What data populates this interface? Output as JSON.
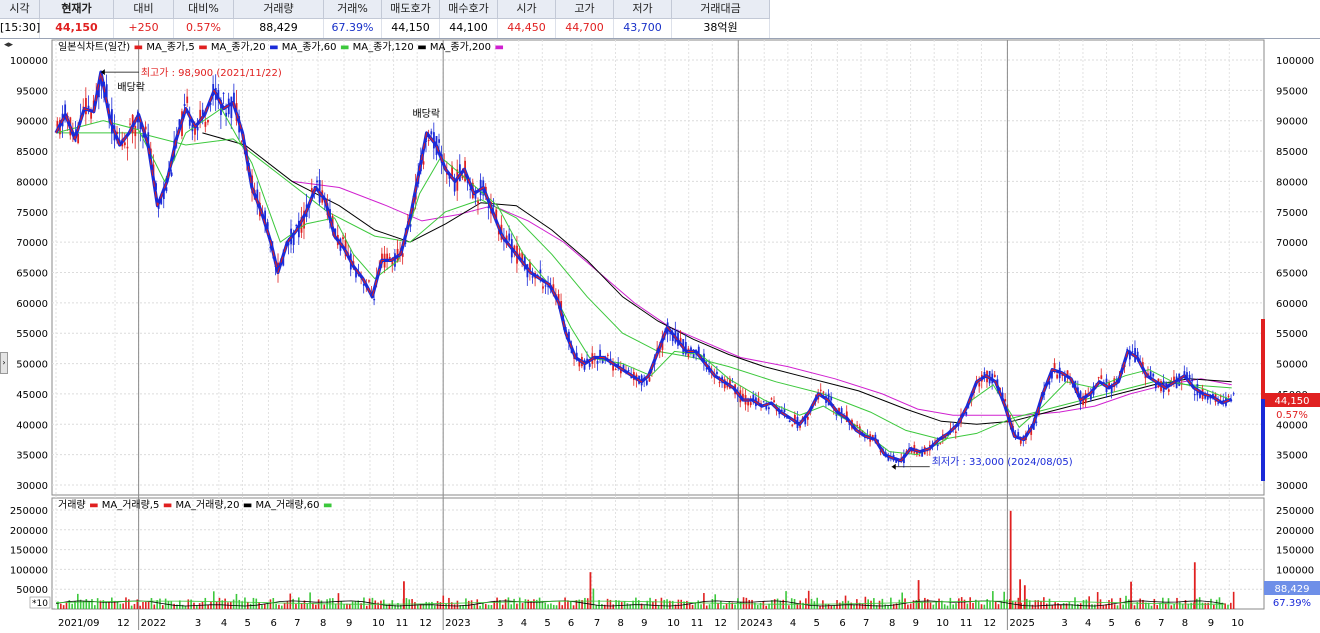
{
  "quote": {
    "headers": [
      "시각",
      "현재가",
      "대비",
      "대비%",
      "거래량",
      "거래%",
      "매도호가",
      "매수호가",
      "시가",
      "고가",
      "저가",
      "거래대금"
    ],
    "values": [
      "[15:30]",
      "44,150",
      "+250",
      "0.57%",
      "88,429",
      "67.39%",
      "44,150",
      "44,100",
      "44,450",
      "44,700",
      "43,700",
      "38억원"
    ]
  },
  "chart_data": {
    "type": "line",
    "title": "일본식차트(일간)",
    "price_legend": [
      {
        "label": "MA_종가,5",
        "color": "#e02020"
      },
      {
        "label": "MA_종가,20",
        "color": "#e02020"
      },
      {
        "label": "MA_종가,60",
        "color": "#1a2ad8"
      },
      {
        "label": "MA_종가,120",
        "color": "#3cc83c"
      },
      {
        "label": "MA_종가,200",
        "color": "#000000"
      },
      {
        "label": "",
        "color": "#d020d0"
      }
    ],
    "volume_legend": [
      {
        "label": "거래량",
        "color": "#e02020"
      },
      {
        "label": "MA_거래량,5",
        "color": "#e02020"
      },
      {
        "label": "MA_거래량,20",
        "color": "#000000"
      },
      {
        "label": "MA_거래량,60",
        "color": "#3cc83c"
      }
    ],
    "price_ylim": [
      30000,
      100000
    ],
    "price_ticks": [
      30000,
      35000,
      40000,
      45000,
      50000,
      55000,
      60000,
      65000,
      70000,
      75000,
      80000,
      85000,
      90000,
      95000,
      100000
    ],
    "volume_ylim": [
      0,
      250000
    ],
    "volume_ticks": [
      50000,
      100000,
      150000,
      200000,
      250000
    ],
    "volume_scale_tag": "*10",
    "x_labels": [
      {
        "t": 0,
        "label": "2021/09"
      },
      {
        "t": 2.5,
        "label": "12"
      },
      {
        "t": 3.5,
        "label": "2022"
      },
      {
        "t": 5.8,
        "label": "3"
      },
      {
        "t": 6.9,
        "label": "4"
      },
      {
        "t": 7.9,
        "label": "5"
      },
      {
        "t": 9.0,
        "label": "6"
      },
      {
        "t": 10.0,
        "label": "7"
      },
      {
        "t": 11.1,
        "label": "8"
      },
      {
        "t": 12.2,
        "label": "9"
      },
      {
        "t": 13.3,
        "label": "10"
      },
      {
        "t": 14.3,
        "label": "11"
      },
      {
        "t": 15.3,
        "label": "12"
      },
      {
        "t": 16.4,
        "label": "2023"
      },
      {
        "t": 18.6,
        "label": "3"
      },
      {
        "t": 19.6,
        "label": "4"
      },
      {
        "t": 20.6,
        "label": "5"
      },
      {
        "t": 21.6,
        "label": "6"
      },
      {
        "t": 22.7,
        "label": "7"
      },
      {
        "t": 23.7,
        "label": "8"
      },
      {
        "t": 24.7,
        "label": "9"
      },
      {
        "t": 25.8,
        "label": "10"
      },
      {
        "t": 26.8,
        "label": "11"
      },
      {
        "t": 27.8,
        "label": "12"
      },
      {
        "t": 28.9,
        "label": "2024"
      },
      {
        "t": 30.0,
        "label": "3"
      },
      {
        "t": 31.0,
        "label": "4"
      },
      {
        "t": 32.0,
        "label": "5"
      },
      {
        "t": 33.1,
        "label": "6"
      },
      {
        "t": 34.1,
        "label": "7"
      },
      {
        "t": 35.2,
        "label": "8"
      },
      {
        "t": 36.2,
        "label": "9"
      },
      {
        "t": 37.2,
        "label": "10"
      },
      {
        "t": 38.2,
        "label": "11"
      },
      {
        "t": 39.2,
        "label": "12"
      },
      {
        "t": 40.3,
        "label": "2025"
      },
      {
        "t": 42.5,
        "label": "3"
      },
      {
        "t": 43.5,
        "label": "4"
      },
      {
        "t": 44.5,
        "label": "5"
      },
      {
        "t": 45.6,
        "label": "6"
      },
      {
        "t": 46.6,
        "label": "7"
      },
      {
        "t": 47.6,
        "label": "8"
      },
      {
        "t": 48.7,
        "label": "9"
      },
      {
        "t": 49.7,
        "label": "10"
      }
    ],
    "year_lines_t": [
      3.5,
      16.4,
      28.9,
      40.3
    ],
    "x_range": [
      0,
      51
    ],
    "price_path": [
      [
        0,
        88000
      ],
      [
        0.4,
        91000
      ],
      [
        0.8,
        87000
      ],
      [
        1.2,
        92000
      ],
      [
        1.6,
        91500
      ],
      [
        1.9,
        98000
      ],
      [
        2.3,
        90000
      ],
      [
        2.7,
        86000
      ],
      [
        3.1,
        88000
      ],
      [
        3.5,
        91000
      ],
      [
        3.9,
        86000
      ],
      [
        4.3,
        76000
      ],
      [
        4.7,
        80000
      ],
      [
        5.1,
        87000
      ],
      [
        5.5,
        92000
      ],
      [
        5.9,
        89000
      ],
      [
        6.3,
        91000
      ],
      [
        6.7,
        95000
      ],
      [
        7.1,
        92000
      ],
      [
        7.5,
        93000
      ],
      [
        7.9,
        88000
      ],
      [
        8.3,
        79000
      ],
      [
        8.7,
        75000
      ],
      [
        9.1,
        70000
      ],
      [
        9.4,
        65000
      ],
      [
        9.8,
        70000
      ],
      [
        10.2,
        72000
      ],
      [
        10.6,
        75000
      ],
      [
        11.0,
        79000
      ],
      [
        11.4,
        77000
      ],
      [
        11.8,
        71000
      ],
      [
        12.2,
        69000
      ],
      [
        12.6,
        66000
      ],
      [
        13.0,
        64000
      ],
      [
        13.4,
        61000
      ],
      [
        13.8,
        67000
      ],
      [
        14.2,
        67000
      ],
      [
        14.6,
        68000
      ],
      [
        15.0,
        74000
      ],
      [
        15.4,
        82000
      ],
      [
        15.7,
        88000
      ],
      [
        16.1,
        86000
      ],
      [
        16.5,
        82000
      ],
      [
        16.9,
        80000
      ],
      [
        17.3,
        82000
      ],
      [
        17.7,
        78000
      ],
      [
        18.1,
        79000
      ],
      [
        18.5,
        75000
      ],
      [
        18.9,
        71000
      ],
      [
        19.3,
        69000
      ],
      [
        19.7,
        67000
      ],
      [
        20.1,
        65000
      ],
      [
        20.5,
        64000
      ],
      [
        20.9,
        63000
      ],
      [
        21.3,
        60000
      ],
      [
        21.6,
        55000
      ],
      [
        22.0,
        51000
      ],
      [
        22.4,
        50000
      ],
      [
        22.8,
        51000
      ],
      [
        23.2,
        51000
      ],
      [
        23.6,
        50000
      ],
      [
        24.0,
        49000
      ],
      [
        24.4,
        48000
      ],
      [
        24.8,
        47000
      ],
      [
        25.1,
        48000
      ],
      [
        25.5,
        52000
      ],
      [
        25.9,
        56000
      ],
      [
        26.3,
        54000
      ],
      [
        26.7,
        52000
      ],
      [
        27.1,
        52000
      ],
      [
        27.5,
        50000
      ],
      [
        27.9,
        48000
      ],
      [
        28.3,
        47000
      ],
      [
        28.7,
        46000
      ],
      [
        29.1,
        44000
      ],
      [
        29.5,
        44000
      ],
      [
        29.9,
        43000
      ],
      [
        30.3,
        43500
      ],
      [
        30.7,
        42000
      ],
      [
        31.1,
        41000
      ],
      [
        31.5,
        40000
      ],
      [
        31.9,
        42000
      ],
      [
        32.3,
        45000
      ],
      [
        32.7,
        44000
      ],
      [
        33.1,
        42000
      ],
      [
        33.5,
        41000
      ],
      [
        33.9,
        39000
      ],
      [
        34.3,
        38000
      ],
      [
        34.7,
        37500
      ],
      [
        35.1,
        35000
      ],
      [
        35.4,
        34500
      ],
      [
        35.8,
        34000
      ],
      [
        36.2,
        36000
      ],
      [
        36.6,
        35500
      ],
      [
        37.0,
        36000
      ],
      [
        37.4,
        37500
      ],
      [
        37.8,
        38500
      ],
      [
        38.2,
        40000
      ],
      [
        38.6,
        43000
      ],
      [
        39.0,
        47000
      ],
      [
        39.4,
        48000
      ],
      [
        39.8,
        47000
      ],
      [
        40.2,
        43000
      ],
      [
        40.6,
        38000
      ],
      [
        41.0,
        37500
      ],
      [
        41.4,
        40000
      ],
      [
        41.8,
        45000
      ],
      [
        42.2,
        49000
      ],
      [
        42.6,
        48500
      ],
      [
        43.0,
        47500
      ],
      [
        43.4,
        44000
      ],
      [
        43.8,
        45000
      ],
      [
        44.2,
        47000
      ],
      [
        44.6,
        46000
      ],
      [
        45.0,
        47000
      ],
      [
        45.4,
        52000
      ],
      [
        45.8,
        51000
      ],
      [
        46.2,
        48000
      ],
      [
        46.6,
        47000
      ],
      [
        47.0,
        46000
      ],
      [
        47.4,
        47000
      ],
      [
        47.8,
        48000
      ],
      [
        48.2,
        46000
      ],
      [
        48.6,
        45000
      ],
      [
        49.0,
        44500
      ],
      [
        49.4,
        43500
      ],
      [
        49.8,
        44150
      ]
    ],
    "ma20_path": [
      [
        0,
        88000
      ],
      [
        2,
        90000
      ],
      [
        3.5,
        88500
      ],
      [
        4.6,
        80000
      ],
      [
        5.5,
        88000
      ],
      [
        7.0,
        92000
      ],
      [
        8.3,
        83000
      ],
      [
        9.5,
        70000
      ],
      [
        10.6,
        73000
      ],
      [
        11.8,
        74000
      ],
      [
        12.6,
        68000
      ],
      [
        13.5,
        64000
      ],
      [
        14.5,
        67000
      ],
      [
        15.4,
        78000
      ],
      [
        16.3,
        84000
      ],
      [
        17.5,
        80000
      ],
      [
        18.7,
        76000
      ],
      [
        19.8,
        68000
      ],
      [
        20.9,
        63000
      ],
      [
        21.8,
        56000
      ],
      [
        22.6,
        51000
      ],
      [
        24.0,
        50000
      ],
      [
        25.2,
        48000
      ],
      [
        26.2,
        52000
      ],
      [
        27.3,
        51500
      ],
      [
        28.5,
        47500
      ],
      [
        30.0,
        44000
      ],
      [
        31.5,
        41500
      ],
      [
        32.5,
        43000
      ],
      [
        33.8,
        40000
      ],
      [
        35.3,
        35500
      ],
      [
        36.5,
        35000
      ],
      [
        37.7,
        37500
      ],
      [
        38.8,
        44000
      ],
      [
        39.7,
        46500
      ],
      [
        40.8,
        39500
      ],
      [
        41.8,
        43000
      ],
      [
        42.8,
        47000
      ],
      [
        44.0,
        46000
      ],
      [
        45.3,
        48000
      ],
      [
        46.3,
        49000
      ],
      [
        47.3,
        47000
      ],
      [
        48.5,
        46000
      ],
      [
        49.8,
        44000
      ]
    ],
    "ma60_path": [
      [
        0,
        88000
      ],
      [
        2,
        90000
      ],
      [
        3.5,
        87000
      ],
      [
        5.2,
        82000
      ],
      [
        6.5,
        88000
      ],
      [
        7.8,
        89000
      ],
      [
        9.0,
        80000
      ],
      [
        10.6,
        74000
      ],
      [
        11.8,
        76000
      ],
      [
        13.0,
        70000
      ],
      [
        14.2,
        66000
      ],
      [
        15.2,
        70000
      ],
      [
        16.5,
        80000
      ],
      [
        17.8,
        78000
      ],
      [
        19.0,
        75000
      ],
      [
        20.4,
        68000
      ],
      [
        21.6,
        60000
      ],
      [
        22.8,
        54000
      ],
      [
        24.2,
        51000
      ],
      [
        25.8,
        49500
      ],
      [
        27.2,
        51000
      ],
      [
        28.6,
        49000
      ],
      [
        30.5,
        45500
      ],
      [
        32.0,
        43500
      ],
      [
        33.6,
        42500
      ],
      [
        35.0,
        39500
      ],
      [
        36.3,
        36500
      ],
      [
        37.6,
        36000
      ],
      [
        38.8,
        39000
      ],
      [
        40.0,
        42000
      ],
      [
        41.2,
        42000
      ],
      [
        42.5,
        44000
      ],
      [
        44.0,
        45500
      ],
      [
        45.5,
        47000
      ],
      [
        46.8,
        48000
      ],
      [
        48.2,
        47000
      ],
      [
        49.8,
        45500
      ]
    ],
    "ma120_path": [
      [
        0,
        88000
      ],
      [
        3.5,
        88000
      ],
      [
        5.5,
        86000
      ],
      [
        7.5,
        87000
      ],
      [
        9.5,
        81000
      ],
      [
        11.5,
        75000
      ],
      [
        13.5,
        71000
      ],
      [
        15.0,
        70000
      ],
      [
        16.5,
        75000
      ],
      [
        18.0,
        77000
      ],
      [
        19.5,
        74000
      ],
      [
        21.0,
        68000
      ],
      [
        22.5,
        61000
      ],
      [
        24.0,
        55000
      ],
      [
        25.5,
        52000
      ],
      [
        27.0,
        51000
      ],
      [
        28.5,
        49500
      ],
      [
        30.5,
        47000
      ],
      [
        32.5,
        45000
      ],
      [
        34.5,
        42000
      ],
      [
        36.0,
        39000
      ],
      [
        37.5,
        37500
      ],
      [
        39.0,
        38500
      ],
      [
        40.5,
        41000
      ],
      [
        42.0,
        42500
      ],
      [
        43.5,
        44000
      ],
      [
        45.0,
        45500
      ],
      [
        46.5,
        47000
      ],
      [
        48.0,
        46500
      ],
      [
        49.8,
        46000
      ]
    ],
    "ma200_path": [
      [
        6.2,
        88000
      ],
      [
        8.0,
        86000
      ],
      [
        10.0,
        80000
      ],
      [
        12.0,
        76000
      ],
      [
        13.5,
        72000
      ],
      [
        15.0,
        70000
      ],
      [
        16.5,
        73000
      ],
      [
        18.0,
        76500
      ],
      [
        19.5,
        76000
      ],
      [
        21.0,
        72000
      ],
      [
        22.5,
        67000
      ],
      [
        24.0,
        61000
      ],
      [
        25.5,
        57000
      ],
      [
        27.0,
        54000
      ],
      [
        28.5,
        51500
      ],
      [
        30.0,
        49500
      ],
      [
        32.0,
        47500
      ],
      [
        34.0,
        45500
      ],
      [
        36.0,
        42500
      ],
      [
        37.5,
        40500
      ],
      [
        39.0,
        40000
      ],
      [
        40.5,
        40500
      ],
      [
        42.0,
        42000
      ],
      [
        43.5,
        43500
      ],
      [
        45.0,
        45000
      ],
      [
        46.5,
        46500
      ],
      [
        48.0,
        47500
      ],
      [
        49.8,
        47000
      ]
    ],
    "ma_magenta_path": [
      [
        10.0,
        80000
      ],
      [
        12.0,
        79000
      ],
      [
        14.0,
        76000
      ],
      [
        15.5,
        73500
      ],
      [
        17.0,
        74500
      ],
      [
        18.5,
        76000
      ],
      [
        20.0,
        73500
      ],
      [
        21.5,
        70000
      ],
      [
        23.0,
        65000
      ],
      [
        24.5,
        60000
      ],
      [
        26.0,
        56000
      ],
      [
        27.5,
        53500
      ],
      [
        29.0,
        51000
      ],
      [
        31.0,
        49500
      ],
      [
        33.0,
        47500
      ],
      [
        35.0,
        45000
      ],
      [
        36.5,
        42500
      ],
      [
        38.0,
        41500
      ],
      [
        39.5,
        41500
      ],
      [
        41.0,
        41500
      ],
      [
        42.5,
        42000
      ],
      [
        44.0,
        43000
      ],
      [
        45.5,
        45000
      ],
      [
        47.0,
        46500
      ],
      [
        48.5,
        47500
      ],
      [
        49.8,
        46500
      ]
    ],
    "volume_spikes": [
      {
        "t": 40.4,
        "v": 248000
      },
      {
        "t": 48.2,
        "v": 118000
      },
      {
        "t": 22.6,
        "v": 93000
      },
      {
        "t": 40.8,
        "v": 75000
      },
      {
        "t": 36.5,
        "v": 73000
      },
      {
        "t": 14.7,
        "v": 70000
      },
      {
        "t": 45.5,
        "v": 69000
      },
      {
        "t": 41.0,
        "v": 60000
      }
    ],
    "annotations": {
      "high_label": "최고가 : 98,900 (2021/11/22)",
      "low_label": "최저가 : 33,000 (2024/08/05)",
      "dividend1": "배당락",
      "dividend2": "배당락"
    },
    "current_price_tag": "44,150",
    "current_change_tag": "0.57%",
    "volume_tag": "88,429",
    "volume_pct_tag": "67.39%"
  },
  "colors": {
    "up": "#e02020",
    "down": "#1a2ad8",
    "ma60": "#1a2ad8",
    "ma120": "#3cc83c",
    "ma200": "#000000",
    "ma_magenta": "#d020d0",
    "grid": "#d9d9d9"
  }
}
